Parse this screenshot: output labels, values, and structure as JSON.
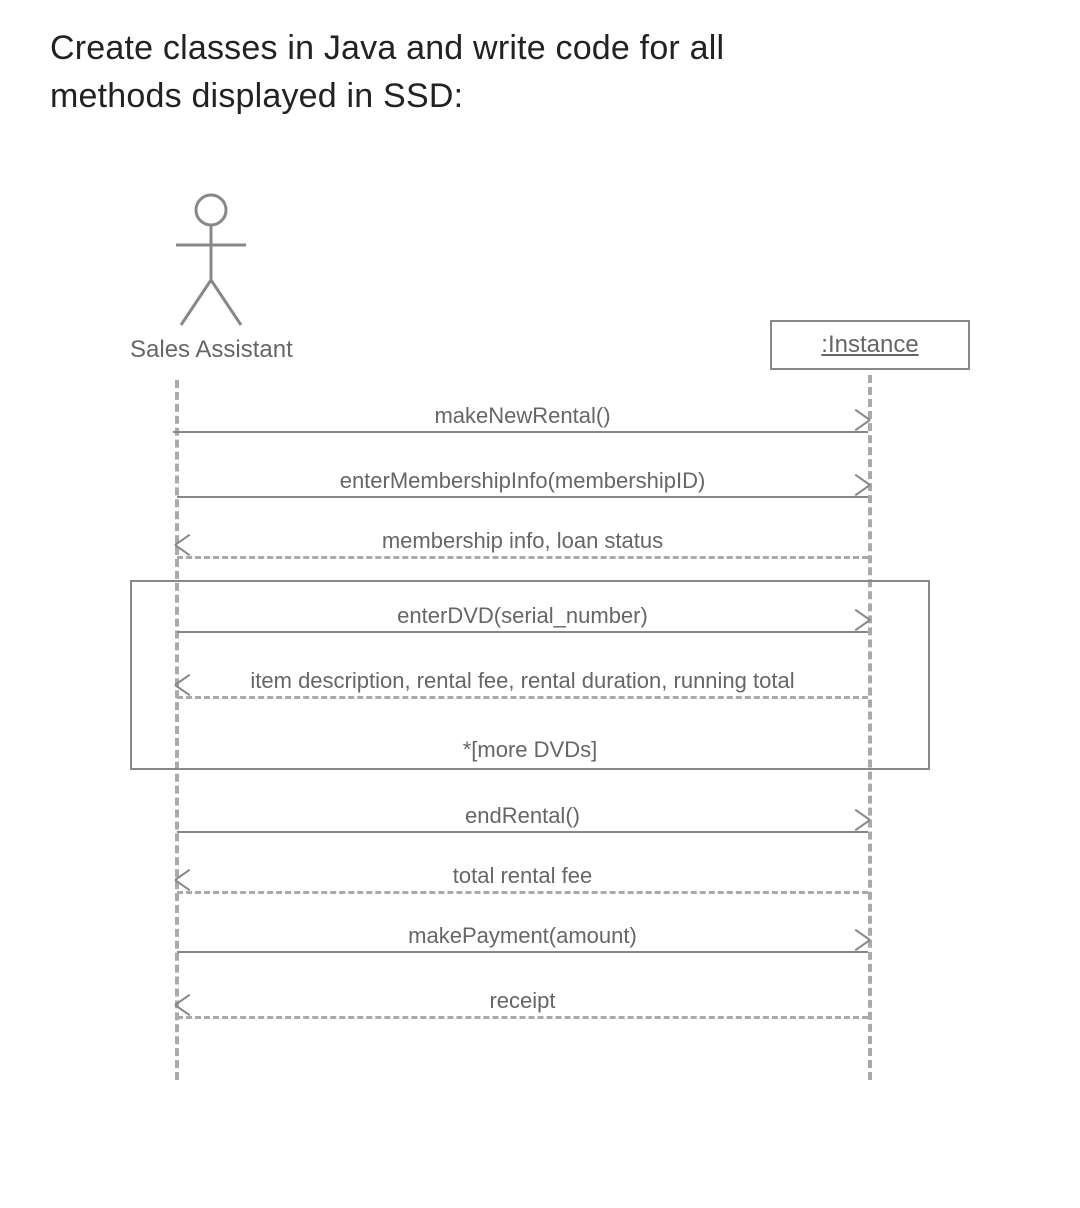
{
  "title_line1": "Create classes in Java and write code for all",
  "title_line2": "methods displayed in SSD:",
  "actor": {
    "label": "Sales Assistant"
  },
  "instance": {
    "label": ":Instance"
  },
  "messages": {
    "m1": "makeNewRental()",
    "m2": "enterMembershipInfo(membershipID)",
    "r1": "membership info, loan status",
    "m3": "enterDVD(serial_number)",
    "r2": "item description, rental fee, rental duration, running total",
    "loop_guard": "*[more DVDs]",
    "m4": "endRental()",
    "r3": "total rental fee",
    "m5": "makePayment(amount)",
    "r4": "receipt"
  }
}
